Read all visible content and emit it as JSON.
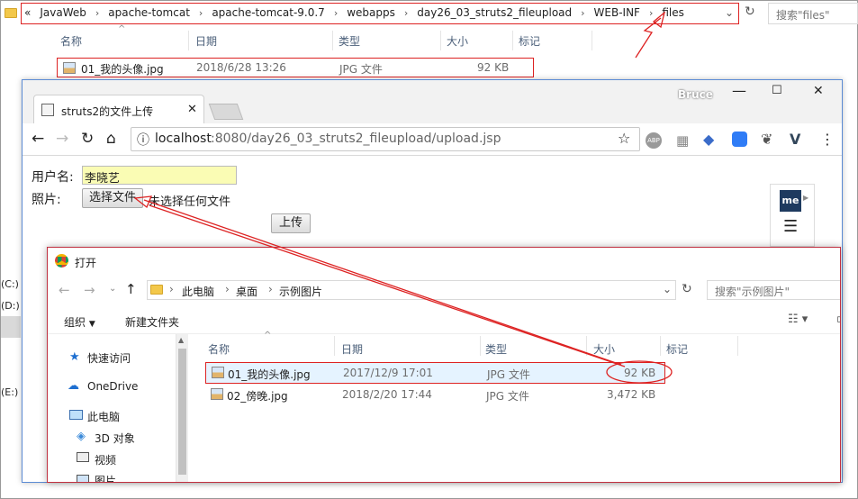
{
  "explorer": {
    "breadcrumb": [
      "«",
      "JavaWeb",
      "apache-tomcat",
      "apache-tomcat-9.0.7",
      "webapps",
      "day26_03_struts2_fileupload",
      "WEB-INF",
      "files"
    ],
    "search_placeholder": "搜索\"files\"",
    "columns": {
      "name": "名称",
      "date": "日期",
      "type": "类型",
      "size": "大小",
      "tags": "标记"
    },
    "file": {
      "name": "01_我的头像.jpg",
      "date": "2018/6/28 13:26",
      "type": "JPG 文件",
      "size": "92 KB"
    },
    "side_drives": [
      "(C:)",
      "(D:)",
      "(E:)"
    ]
  },
  "browser": {
    "user": "Bruce",
    "tab_title": "struts2的文件上传",
    "url_host": "localhost",
    "url_rest": ":8080/day26_03_struts2_fileupload/upload.jsp",
    "ext_badge": "me",
    "form": {
      "username_label": "用户名:",
      "username_value": "李晓艺",
      "photo_label": "照片:",
      "choose_button": "选择文件",
      "no_file_text": "未选择任何文件",
      "submit_button": "上传"
    }
  },
  "dialog": {
    "title": "打开",
    "path": [
      "此电脑",
      "桌面",
      "示例图片"
    ],
    "search_placeholder": "搜索\"示例图片\"",
    "organize": "组织",
    "new_folder": "新建文件夹",
    "columns": {
      "name": "名称",
      "date": "日期",
      "type": "类型",
      "size": "大小",
      "tags": "标记"
    },
    "nav": [
      "快速访问",
      "OneDrive",
      "此电脑",
      "3D 对象",
      "视频",
      "图片"
    ],
    "files": [
      {
        "name": "01_我的头像.jpg",
        "date": "2017/12/9 17:01",
        "type": "JPG 文件",
        "size": "92 KB"
      },
      {
        "name": "02_傍晚.jpg",
        "date": "2018/2/20 17:44",
        "type": "JPG 文件",
        "size": "3,472 KB"
      }
    ]
  },
  "colors": {
    "annotation_red": "#dd2222",
    "selection_blue": "#cce8ff",
    "input_yellow": "#fafcb4"
  }
}
